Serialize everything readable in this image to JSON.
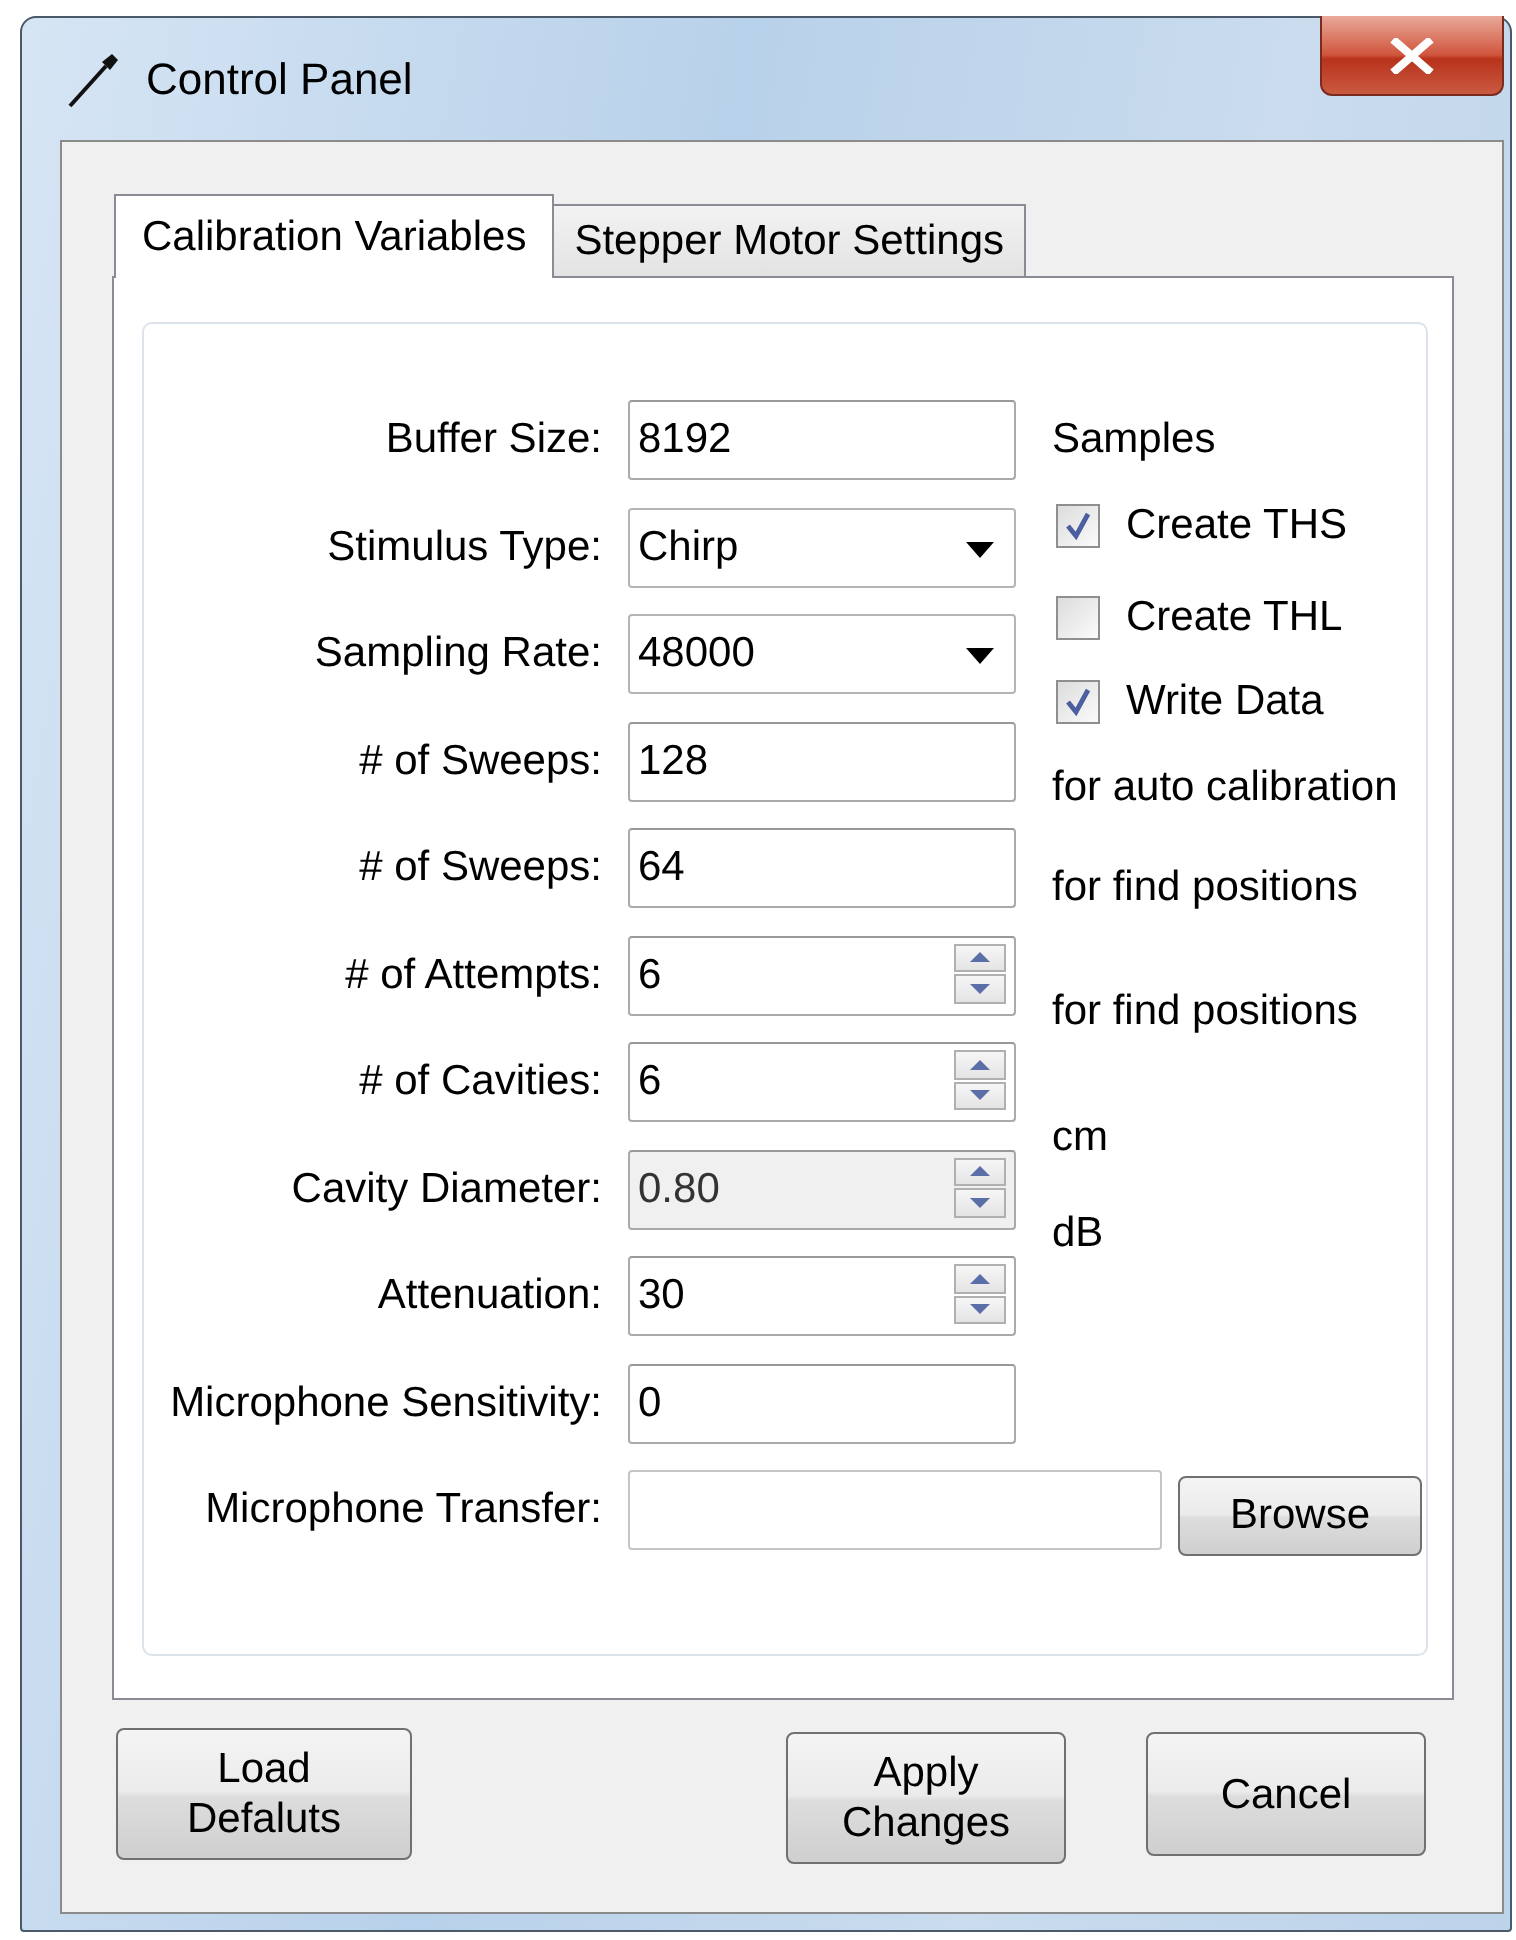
{
  "window": {
    "title": "Control Panel"
  },
  "tabs": [
    {
      "label": "Calibration Variables",
      "selected": true
    },
    {
      "label": "Stepper Motor Settings",
      "selected": false
    }
  ],
  "fields": [
    {
      "label": "Buffer Size:",
      "kind": "text",
      "value": "8192"
    },
    {
      "label": "Stimulus Type:",
      "kind": "combo",
      "value": "Chirp"
    },
    {
      "label": "Sampling Rate:",
      "kind": "combo",
      "value": "48000"
    },
    {
      "label": "# of Sweeps:",
      "kind": "text",
      "value": "128"
    },
    {
      "label": "# of Sweeps:",
      "kind": "text",
      "value": "64"
    },
    {
      "label": "# of Attempts:",
      "kind": "spin",
      "value": "6",
      "disabled": false
    },
    {
      "label": "# of Cavities:",
      "kind": "spin",
      "value": "6",
      "disabled": false
    },
    {
      "label": "Cavity Diameter:",
      "kind": "spin",
      "value": "0.80",
      "disabled": true
    },
    {
      "label": "Attenuation:",
      "kind": "spin",
      "value": "30",
      "disabled": false
    },
    {
      "label": "Microphone Sensitivity:",
      "kind": "text",
      "value": "0"
    },
    {
      "label": "Microphone Transfer:",
      "kind": "file",
      "button": "Browse"
    }
  ],
  "side_notes": [
    {
      "kind": "note",
      "text": "Samples"
    },
    {
      "kind": "checkbox",
      "text": "Create THS",
      "checked": true
    },
    {
      "kind": "checkbox",
      "text": "Create THL",
      "checked": false
    },
    {
      "kind": "checkbox",
      "text": "Write Data",
      "checked": true
    },
    {
      "kind": "note",
      "text": "for auto calibration"
    },
    {
      "kind": "note",
      "text": "for find positions"
    },
    {
      "kind": "note",
      "text": "for find positions"
    },
    {
      "kind": "note",
      "text": "cm"
    },
    {
      "kind": "note",
      "text": "dB"
    }
  ],
  "buttons": [
    {
      "label": "Load\nDefaluts"
    },
    {
      "label": "Apply\nChanges"
    },
    {
      "label": "Cancel"
    }
  ]
}
